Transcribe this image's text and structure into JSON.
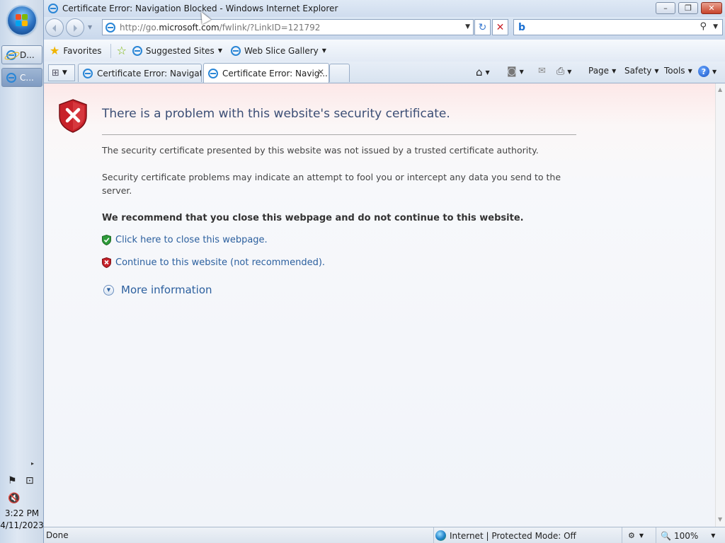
{
  "window": {
    "title": "Certificate Error: Navigation Blocked - Windows Internet Explorer",
    "controls": {
      "minimize": "–",
      "restore": "❐",
      "close": "✕"
    }
  },
  "taskbar": {
    "buttons": [
      {
        "label": "D...",
        "icon": "ie-globe-icon"
      },
      {
        "label": "C...",
        "icon": "ie-icon"
      }
    ],
    "tray_arrow": "▸",
    "time": "3:22 PM",
    "date": "4/11/2023"
  },
  "navigation": {
    "url_prefix": "http://go.",
    "url_domain": "microsoft.com",
    "url_rest": "/fwlink/?LinkID=121792",
    "refresh_icon": "↻",
    "stop_icon": "✕",
    "search_placeholder": "",
    "search_engine": "b"
  },
  "favorites": {
    "favorites_label": "Favorites",
    "suggested_sites_label": "Suggested Sites",
    "web_slice_label": "Web Slice Gallery"
  },
  "tabs": [
    {
      "label": "Certificate Error: Navigatio...",
      "active": false
    },
    {
      "label": "Certificate Error: Navig...",
      "active": true
    }
  ],
  "command_bar": {
    "page_label": "Page",
    "safety_label": "Safety",
    "tools_label": "Tools",
    "help_label": "?"
  },
  "page": {
    "heading": "There is a problem with this website's security certificate.",
    "para1": "The security certificate presented by this website was not issued by a trusted certificate authority.",
    "para2": "Security certificate problems may indicate an attempt to fool you or intercept any data you send to the server.",
    "recommendation": "We recommend that you close this webpage and do not continue to this website.",
    "close_link": "Click here to close this webpage.",
    "continue_link": "Continue to this website (not recommended).",
    "more_info": "More information"
  },
  "status": {
    "text": "Done",
    "zone": "Internet | Protected Mode: Off",
    "zoom": "100%"
  },
  "colors": {
    "link": "#2b5f9e",
    "heading": "#3b4e75",
    "shield_red": "#c8222a",
    "shield_green": "#2e9b3a"
  }
}
